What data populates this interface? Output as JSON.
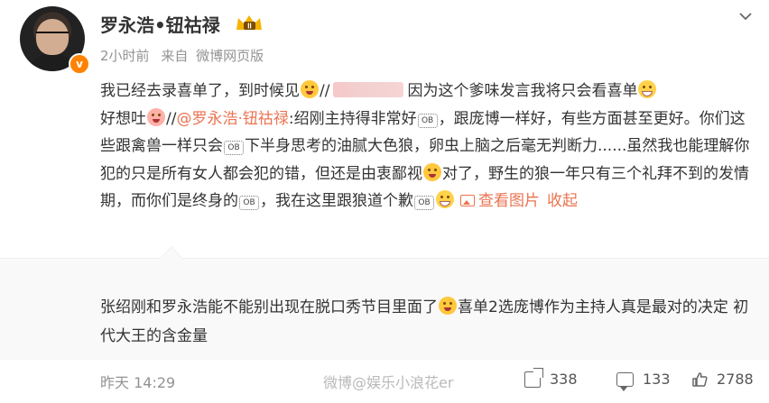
{
  "user": {
    "name": "罗永浩•钮祜禄",
    "badge_level": "II",
    "verified_mark": "v",
    "timestamp": "2小时前",
    "source_prefix": "来自",
    "source": "微博网页版"
  },
  "post": {
    "t1": "我已经去录喜单了，到时候见",
    "t2": "因为这个爹味发言我将只会看喜单",
    "t3": "好想吐",
    "t4": "//",
    "mention": "@罗永浩·钮祜禄",
    "t5": ":绍刚主持得非常好",
    "t6": "，跟庞博一样好，有些方面甚至更好。你们这些跟禽兽一样只会",
    "t7": "下半身思考的油腻大色狼，卵虫上脑之后毫无判断力......虽然我也能理解你犯的只是所有女人都会犯的错，但还是由衷鄙视",
    "t8": "对了，野生的狼一年只有三个礼拜不到的发情期，而你们是终身的",
    "t9": "，我在这里跟狼道个歉",
    "view_image": "查看图片",
    "collapse": "收起",
    "sticker_text": "OB"
  },
  "comment": {
    "text": "张绍刚和罗永浩能不能别出现在脱口秀节目里面了",
    "text2": "喜单2选庞博作为主持人真是最对的决定 初代大王的含金量"
  },
  "footer": {
    "time": "昨天 14:29",
    "watermark": "微博@娱乐小浪花er",
    "share_count": "338",
    "comment_count": "133",
    "like_count": "2788"
  },
  "colors": {
    "accent": "#eb7350",
    "meta": "#939393",
    "comment_bg": "#f9f9f9",
    "badge": "#ff8200"
  }
}
